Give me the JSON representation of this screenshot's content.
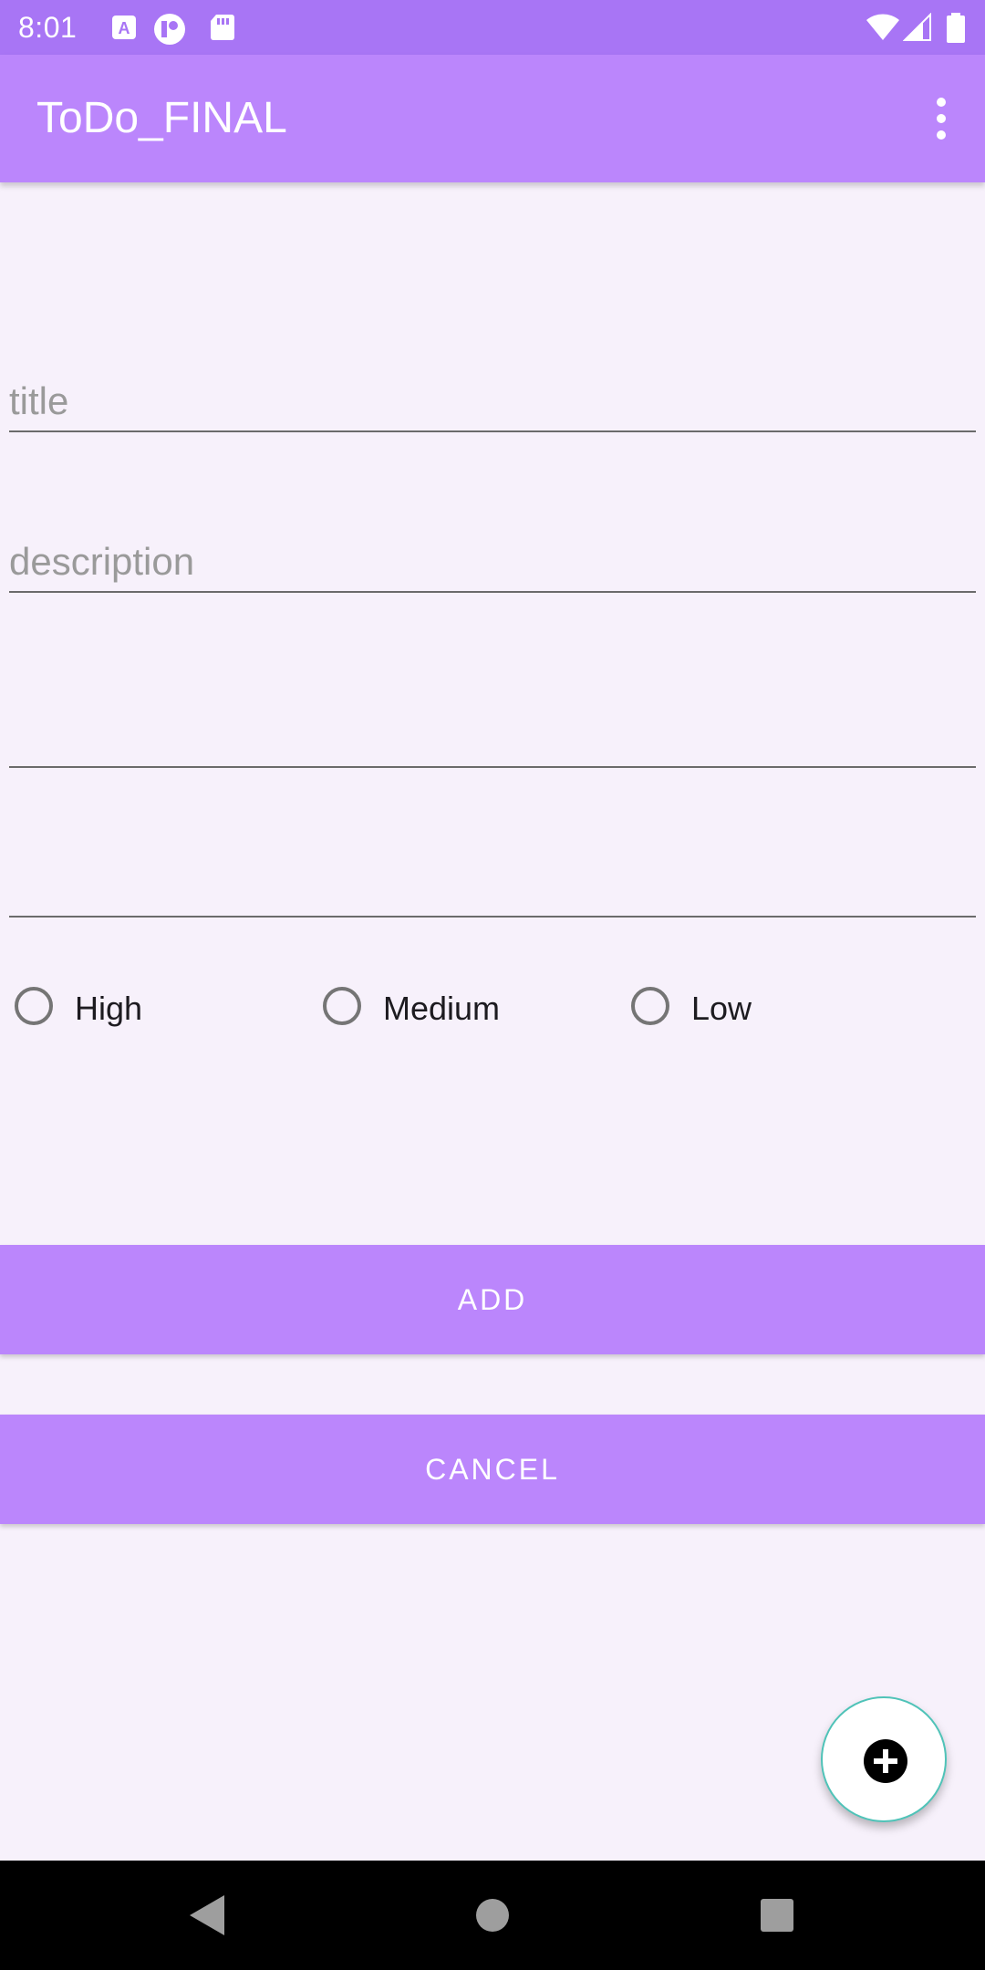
{
  "status_bar": {
    "time": "8:01",
    "icons": [
      "autofill-a-icon",
      "podcast-icon",
      "sd-card-icon",
      "wifi-icon",
      "signal-icon",
      "battery-icon"
    ]
  },
  "app_bar": {
    "title": "ToDo_FINAL",
    "overflow_icon": "more-vert-icon"
  },
  "form": {
    "title_placeholder": "title",
    "description_placeholder": "description",
    "field3_value": "",
    "field4_value": ""
  },
  "priority": {
    "options": [
      "High",
      "Medium",
      "Low"
    ],
    "selected": null
  },
  "buttons": {
    "add_label": "ADD",
    "cancel_label": "CANCEL"
  },
  "fab": {
    "icon": "add-circle-icon"
  },
  "nav_bar": {
    "icons": [
      "back-icon",
      "home-icon",
      "recents-icon"
    ]
  },
  "colors": {
    "status_bar": "#a875f5",
    "app_bar": "#bb86fc",
    "background": "#f7f1fb",
    "button": "#bb86fc",
    "fab_border": "#4fc3b8"
  }
}
